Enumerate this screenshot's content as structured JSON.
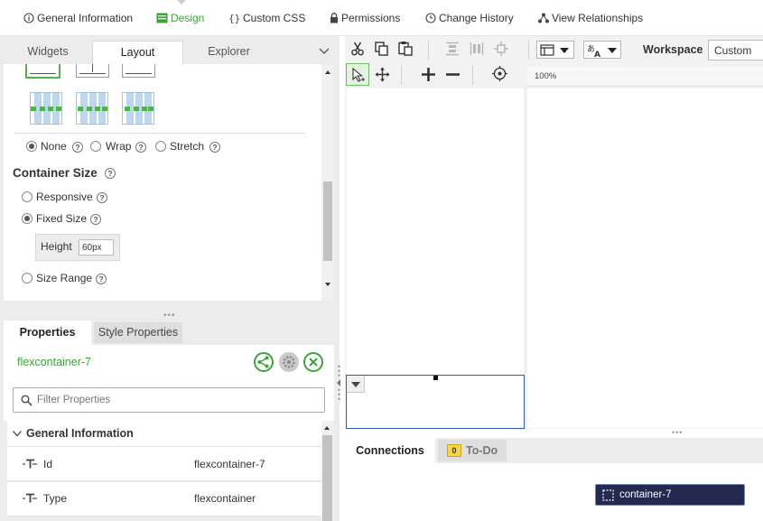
{
  "nav": {
    "items": [
      {
        "label": "General Information",
        "icon": "info-icon"
      },
      {
        "label": "Design",
        "icon": "design-icon",
        "active": true
      },
      {
        "label": "Custom CSS",
        "icon": "css-braces-icon"
      },
      {
        "label": "Permissions",
        "icon": "lock-icon"
      },
      {
        "label": "Change History",
        "icon": "clock-icon"
      },
      {
        "label": "View Relationships",
        "icon": "relationships-icon"
      }
    ]
  },
  "left_tabs": {
    "widgets": "Widgets",
    "layout": "Layout",
    "explorer": "Explorer",
    "active": "Layout"
  },
  "layout": {
    "align_options": [
      {
        "label": "None",
        "selected": true
      },
      {
        "label": "Wrap",
        "selected": false
      },
      {
        "label": "Stretch",
        "selected": false
      }
    ],
    "container_size_title": "Container Size",
    "size_options": [
      {
        "label": "Responsive",
        "selected": false
      },
      {
        "label": "Fixed Size",
        "selected": true
      },
      {
        "label": "Size Range",
        "selected": false
      }
    ],
    "height_label": "Height",
    "height_value": "60px"
  },
  "properties": {
    "tab_properties": "Properties",
    "tab_style": "Style Properties",
    "widget_id": "flexcontainer-7",
    "filter_placeholder": "Filter Properties",
    "section_title": "General Information",
    "rows": [
      {
        "name": "Id",
        "value": "flexcontainer-7"
      },
      {
        "name": "Type",
        "value": "flexcontainer"
      }
    ]
  },
  "toolbar": {
    "workspace_label": "Workspace",
    "workspace_value": "Custom",
    "zoom": "100%"
  },
  "bottom": {
    "tab_connections": "Connections",
    "tab_todo": "To-Do",
    "todo_count": "0",
    "selected_container": "container-7"
  },
  "colors": {
    "accent_green": "#3aa535",
    "selection_blue": "#2d5cc2",
    "chip_navy": "#23294f"
  }
}
